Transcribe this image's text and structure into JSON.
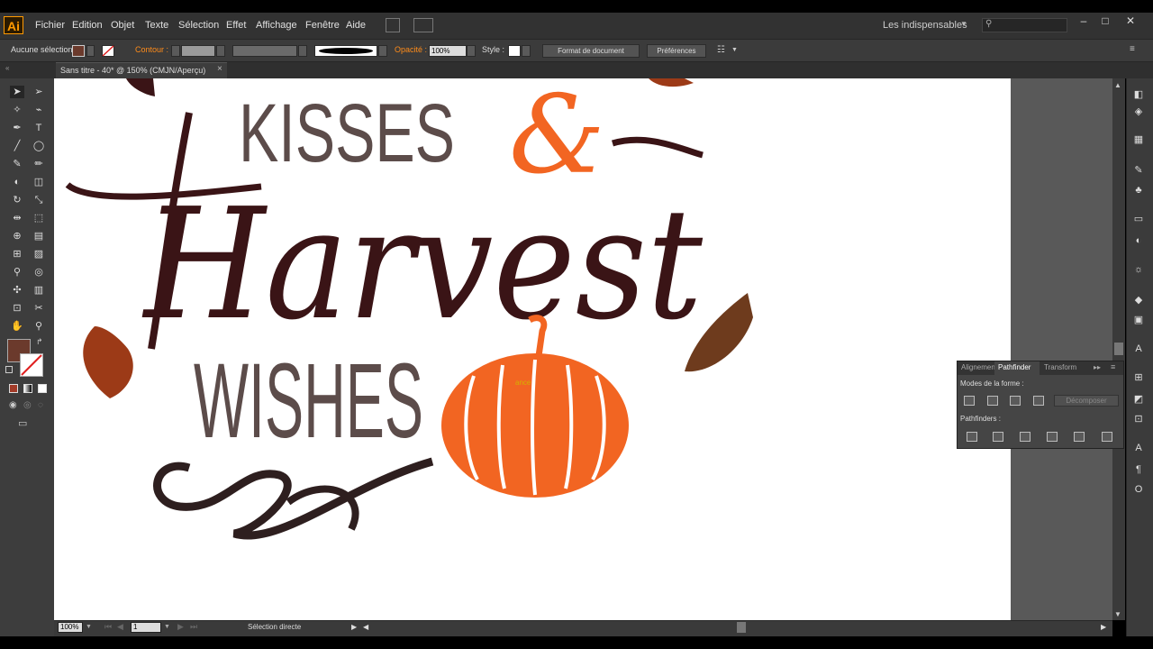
{
  "app": {
    "logo": "Ai"
  },
  "menu": {
    "items": [
      "Fichier",
      "Edition",
      "Objet",
      "Texte",
      "Sélection",
      "Effet",
      "Affichage",
      "Fenêtre",
      "Aide"
    ]
  },
  "workspace": {
    "label": "Les indispensables"
  },
  "window_controls": {
    "minimize": "–",
    "maximize": "□",
    "close": "✕"
  },
  "control_bar": {
    "selection_label": "Aucune sélection",
    "stroke_label": "Contour :",
    "opacity_label": "Opacité :",
    "opacity_value": "100%",
    "style_label": "Style :",
    "doc_format_button": "Format de document",
    "preferences_button": "Préférences"
  },
  "document_tab": {
    "title": "Sans titre - 40* @ 150% (CMJN/Aperçu)",
    "close": "×"
  },
  "artwork": {
    "line1": "KISSES",
    "ampersand": "&",
    "line2": "Harvest",
    "line3": "WISHES",
    "pumpkin_hint": "ance",
    "colors": {
      "dark": "#3a1416",
      "gray": "#5c4c4a",
      "orange": "#f26522",
      "leaf": "#9c3a17",
      "leaf_right": "#6e3b1d"
    }
  },
  "pathfinder": {
    "tabs": [
      "Alignement",
      "Pathfinder",
      "Transform"
    ],
    "shape_modes_label": "Modes de la forme :",
    "expand_button": "Décomposer",
    "pathfinders_label": "Pathfinders :"
  },
  "status": {
    "zoom": "100%",
    "artboard": "1",
    "tool": "Sélection directe"
  },
  "tool_colors": {
    "fill": "#6b3a2c",
    "stroke": "#ffffff"
  }
}
